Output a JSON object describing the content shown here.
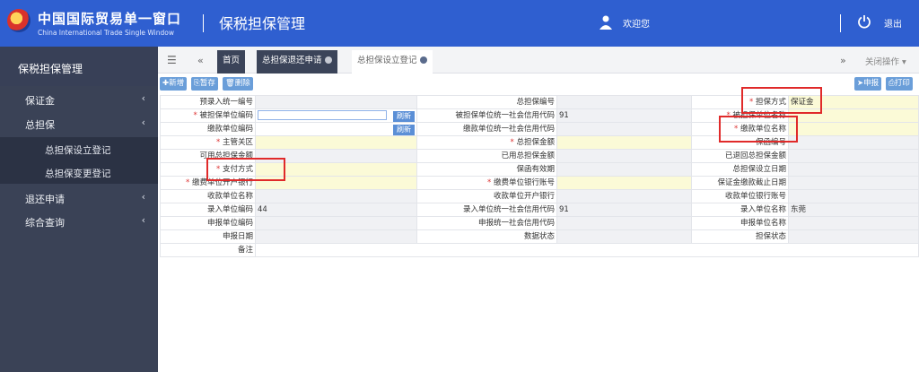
{
  "header": {
    "brand_cn": "中国国际贸易单一窗口",
    "brand_en": "China International Trade Single Window",
    "system_title": "保税担保管理",
    "welcome": "欢迎您",
    "logout": "退出"
  },
  "sidebar": {
    "title": "保税担保管理",
    "items": [
      {
        "label": "保证金"
      },
      {
        "label": "总担保"
      },
      {
        "label": "总担保设立登记"
      },
      {
        "label": "总担保变更登记"
      },
      {
        "label": "退还申请"
      },
      {
        "label": "综合查询"
      }
    ]
  },
  "tabs": {
    "home": "首页",
    "tab1": "总担保退还申请",
    "tab2": "总担保设立登记",
    "close_ops": "关闭操作"
  },
  "toolbar": {
    "add": "新增",
    "save": "暂存",
    "delete": "删除",
    "submit": "申报",
    "print": "打印"
  },
  "form": {
    "rows": [
      [
        "预录入统一编号",
        "",
        "总担保编号",
        "",
        "担保方式",
        "保证金"
      ],
      [
        "被担保单位编码",
        "",
        "被担保单位统一社会信用代码",
        "91",
        "被担保单位名称",
        ""
      ],
      [
        "缴款单位编码",
        "",
        "缴款单位统一社会信用代码",
        "",
        "缴款单位名称",
        ""
      ],
      [
        "主管关区",
        "",
        "总担保金额",
        "",
        "保函编号",
        ""
      ],
      [
        "可用总担保金额",
        "",
        "已用总担保金额",
        "",
        "已退回总担保金额",
        ""
      ],
      [
        "支付方式",
        "",
        "保函有效期",
        "",
        "总担保设立日期",
        ""
      ],
      [
        "缴费单位开户银行",
        "",
        "缴费单位银行账号",
        "",
        "保证金缴款截止日期",
        ""
      ],
      [
        "收款单位名称",
        "",
        "收款单位开户银行",
        "",
        "收款单位银行账号",
        ""
      ],
      [
        "录入单位编码",
        "44",
        "录入单位统一社会信用代码",
        "91",
        "录入单位名称",
        "东莞"
      ],
      [
        "申报单位编码",
        "",
        "申报统一社会信用代码",
        "",
        "申报单位名称",
        ""
      ],
      [
        "申报日期",
        "",
        "数据状态",
        "",
        "担保状态",
        ""
      ]
    ],
    "remark_label": "备注",
    "refresh_label": "刷新"
  }
}
